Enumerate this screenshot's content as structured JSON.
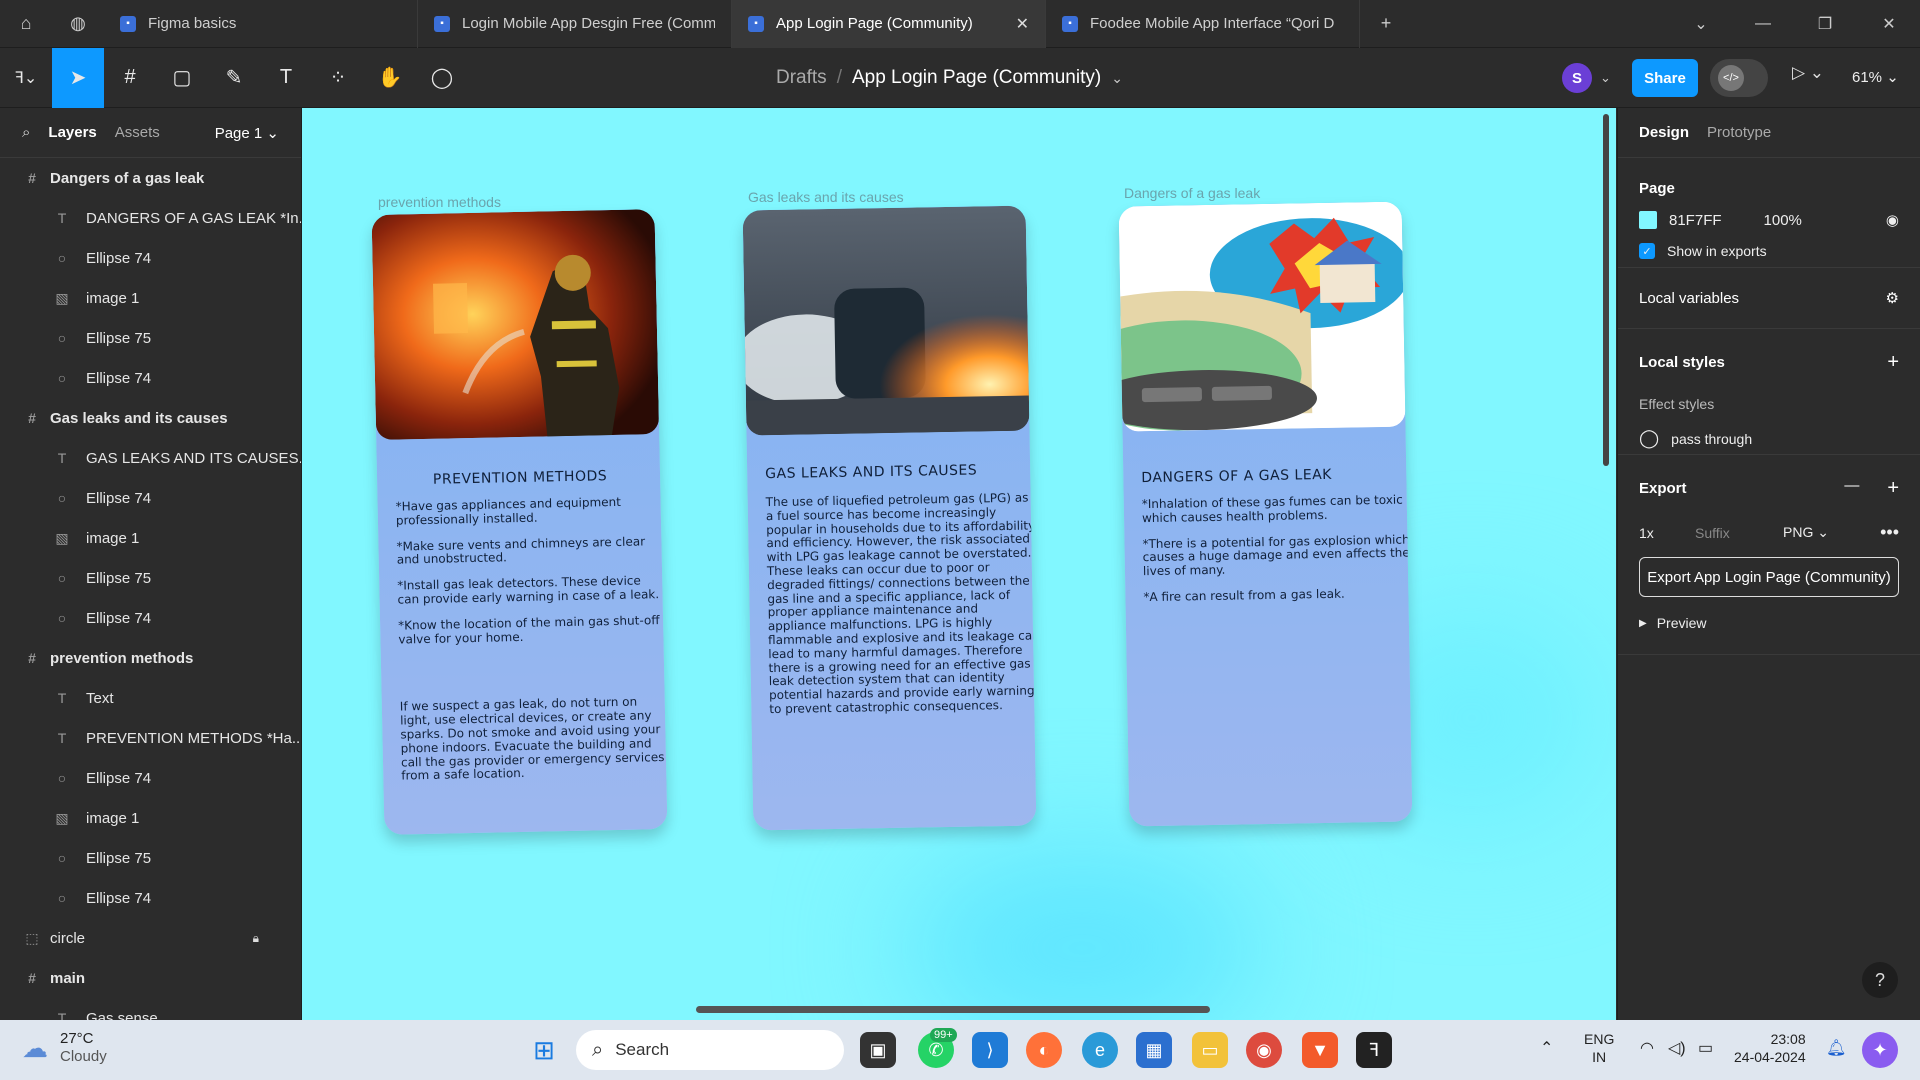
{
  "tabs": [
    {
      "label": "Figma basics",
      "active": false
    },
    {
      "label": "Login Mobile App Desgin Free (Comm",
      "active": false
    },
    {
      "label": "App Login Page (Community)",
      "active": true
    },
    {
      "label": "Foodee Mobile App Interface “Qori D",
      "active": false
    }
  ],
  "breadcrumb": {
    "parent": "Drafts",
    "separator": "/",
    "file": "App Login Page (Community)"
  },
  "user": {
    "initial": "S",
    "avatar_color": "#6b3fd6"
  },
  "toolbar": {
    "share_label": "Share",
    "zoom": "61%"
  },
  "left_panel": {
    "tab_layers": "Layers",
    "tab_assets": "Assets",
    "page_select": "Page 1",
    "layers": [
      {
        "type": "frame",
        "name": "Dangers of a gas leak"
      },
      {
        "type": "text",
        "name": "DANGERS OF A GAS LEAK *In..."
      },
      {
        "type": "ellipse",
        "name": "Ellipse 74"
      },
      {
        "type": "image",
        "name": "image 1"
      },
      {
        "type": "ellipse",
        "name": "Ellipse 75"
      },
      {
        "type": "ellipse",
        "name": "Ellipse 74"
      },
      {
        "type": "frame",
        "name": "Gas leaks and its causes"
      },
      {
        "type": "text",
        "name": "GAS LEAKS AND ITS CAUSES..."
      },
      {
        "type": "ellipse",
        "name": "Ellipse 74"
      },
      {
        "type": "image",
        "name": "image 1"
      },
      {
        "type": "ellipse",
        "name": "Ellipse 75"
      },
      {
        "type": "ellipse",
        "name": "Ellipse 74"
      },
      {
        "type": "frame",
        "name": "prevention methods"
      },
      {
        "type": "text",
        "name": "Text"
      },
      {
        "type": "text",
        "name": "PREVENTION METHODS *Ha..."
      },
      {
        "type": "ellipse",
        "name": "Ellipse 74"
      },
      {
        "type": "image",
        "name": "image 1"
      },
      {
        "type": "ellipse",
        "name": "Ellipse 75"
      },
      {
        "type": "ellipse",
        "name": "Ellipse 74"
      },
      {
        "type": "group",
        "name": "circle",
        "locked": true
      },
      {
        "type": "frame",
        "name": "main"
      },
      {
        "type": "text",
        "name": "Gas sense"
      }
    ]
  },
  "canvas": {
    "background": "#81F7FF",
    "frames": [
      {
        "label": "prevention methods",
        "title": "PREVENTION   METHODS",
        "paragraphs": [
          "*Have gas appliances and equipment professionally installed.",
          "*Make sure vents and chimneys are clear and unobstructed.",
          "*Install gas leak detectors. These device can provide early warning in case of a leak.",
          "*Know the location of the main gas shut-off valve for your home.",
          "",
          "If we suspect a gas leak, do not turn on light, use electrical devices, or create any sparks. Do not smoke and avoid using your phone indoors. Evacuate the building and call the gas provider or emergency services from a safe location."
        ]
      },
      {
        "label": "Gas leaks and its causes",
        "title": "GAS LEAKS AND ITS CAUSES",
        "paragraphs": [
          "The use of liquefied petroleum gas (LPG) as a fuel source has become increasingly popular in households due to its affordability and efficiency. However, the risk associated with LPG gas leakage cannot be overstated. These leaks can occur due to poor or degraded fittings/ connections between the gas line and a specific appliance, lack of proper appliance maintenance and appliance malfunctions. LPG is highly flammable and explosive and its leakage can lead to many harmful damages. Therefore there is a growing need for an effective gas leak detection system that can identity potential hazards and provide early warning to prevent catastrophic consequences."
        ]
      },
      {
        "label": "Dangers of a gas leak",
        "title": "DANGERS OF A GAS LEAK",
        "paragraphs": [
          "*Inhalation of these gas fumes can be toxic which causes health problems.",
          "*There is a potential for gas explosion which causes a huge damage and even affects the lives of many.",
          "*A fire can result from a gas leak."
        ]
      }
    ]
  },
  "right_panel": {
    "tab_design": "Design",
    "tab_prototype": "Prototype",
    "page_section": "Page",
    "page_color": "81F7FF",
    "page_opacity": "100%",
    "show_in_exports": "Show in exports",
    "local_variables": "Local variables",
    "local_styles": "Local styles",
    "effect_styles": "Effect styles",
    "effect_name": "pass through",
    "export": "Export",
    "export_scale": "1x",
    "export_suffix_placeholder": "Suffix",
    "export_format": "PNG",
    "export_button": "Export App Login Page (Community)",
    "preview": "Preview"
  },
  "taskbar": {
    "temp": "27°C",
    "condition": "Cloudy",
    "search_placeholder": "Search",
    "whatsapp_badge": "99+",
    "lang_top": "ENG",
    "lang_bottom": "IN",
    "time": "23:08",
    "date": "24-04-2024"
  }
}
